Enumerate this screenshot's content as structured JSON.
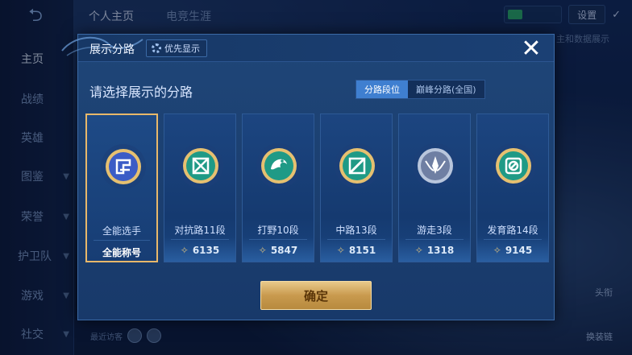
{
  "background": {
    "nav_items": [
      {
        "label": "主页",
        "active": true
      },
      {
        "label": "战绩"
      },
      {
        "label": "英雄"
      },
      {
        "label": "图鉴"
      },
      {
        "label": "荣誉"
      },
      {
        "label": "护卫队"
      },
      {
        "label": "游戏"
      },
      {
        "label": "社交"
      }
    ],
    "top_tabs": [
      {
        "label": "个人主页",
        "active": true
      },
      {
        "label": "电竞生涯"
      }
    ],
    "settings_label": "设置",
    "side_text": "主和数据展示",
    "bottom_visitors": "最近访客",
    "right_labels": [
      "头衔",
      "换装链"
    ]
  },
  "dialog": {
    "title": "展示分路",
    "priority_label": "优先显示",
    "close_icon": "close-icon",
    "prompt": "请选择展示的分路",
    "tabs": [
      {
        "label": "分路段位",
        "active": true
      },
      {
        "label": "巅峰分路(全国)",
        "active": false
      }
    ],
    "cards": [
      {
        "name": "全能选手",
        "value": "全能称号",
        "selected": true,
        "emblem": "all-round-icon",
        "emblem_color": "#3b5cc6"
      },
      {
        "name": "对抗路11段",
        "value": "6135",
        "emblem": "clash-lane-icon",
        "emblem_color": "#1f9a86"
      },
      {
        "name": "打野10段",
        "value": "5847",
        "emblem": "jungle-icon",
        "emblem_color": "#1f9a86"
      },
      {
        "name": "中路13段",
        "value": "8151",
        "emblem": "mid-lane-icon",
        "emblem_color": "#1f9a86"
      },
      {
        "name": "游走3段",
        "value": "1318",
        "emblem": "roam-icon",
        "emblem_color": "#6f7fa3"
      },
      {
        "name": "发育路14段",
        "value": "9145",
        "emblem": "farm-lane-icon",
        "emblem_color": "#1f9a86"
      }
    ],
    "confirm_label": "确定"
  },
  "colors": {
    "accent_gold": "#e8b86a",
    "tab_active": "#3f7fd0",
    "dialog_bg": "#1f4678",
    "confirm_text": "#5a3508"
  }
}
